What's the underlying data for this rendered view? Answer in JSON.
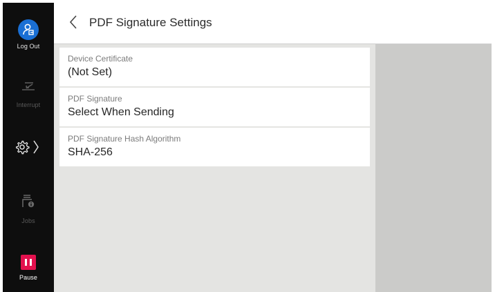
{
  "sidebar": {
    "logout_label": "Log Out",
    "interrupt_label": "Interrupt",
    "jobs_label": "Jobs",
    "pause_label": "Pause"
  },
  "header": {
    "title": "PDF Signature Settings"
  },
  "settings": [
    {
      "label": "Device Certificate",
      "value": "(Not Set)"
    },
    {
      "label": "PDF Signature",
      "value": "Select When Sending"
    },
    {
      "label": "PDF Signature Hash Algorithm",
      "value": "SHA-256"
    }
  ],
  "icons": {
    "logout": "user-logout-icon",
    "interrupt": "interrupt-icon",
    "settings": "gear-icon",
    "jobs": "jobs-icon",
    "pause": "pause-icon",
    "back": "chevron-left-icon"
  },
  "colors": {
    "accent_blue": "#1a6fd4",
    "pause_red": "#e3114e",
    "sidebar_bg": "#0e0e0e"
  }
}
